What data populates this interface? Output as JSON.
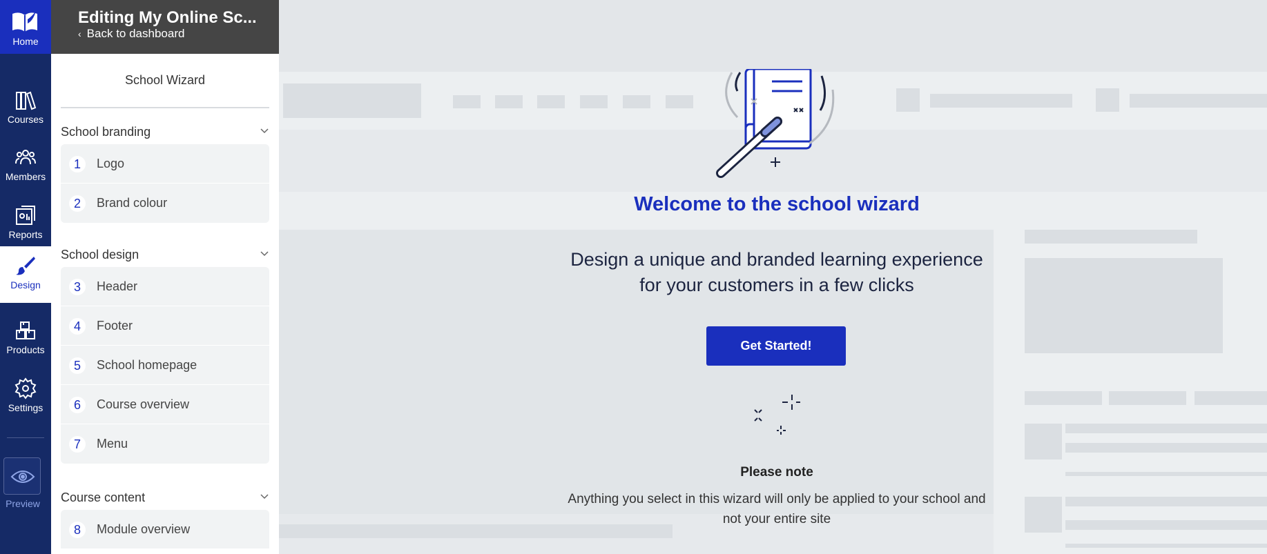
{
  "rail": {
    "home_label": "Home",
    "items": [
      {
        "label": "Courses",
        "icon": "books-icon"
      },
      {
        "label": "Members",
        "icon": "members-icon"
      },
      {
        "label": "Reports",
        "icon": "reports-icon"
      },
      {
        "label": "Design",
        "icon": "brush-icon",
        "active": true
      },
      {
        "label": "Products",
        "icon": "boxes-icon"
      },
      {
        "label": "Settings",
        "icon": "gear-icon"
      }
    ],
    "preview_label": "Preview"
  },
  "panel": {
    "title": "Editing My Online Sc...",
    "back_label": "Back to dashboard",
    "wizard_title": "School Wizard",
    "sections": [
      {
        "title": "School branding",
        "steps": [
          {
            "num": "1",
            "label": "Logo"
          },
          {
            "num": "2",
            "label": "Brand colour"
          }
        ]
      },
      {
        "title": "School design",
        "steps": [
          {
            "num": "3",
            "label": "Header"
          },
          {
            "num": "4",
            "label": "Footer"
          },
          {
            "num": "5",
            "label": "School homepage"
          },
          {
            "num": "6",
            "label": "Course overview"
          },
          {
            "num": "7",
            "label": "Menu"
          }
        ]
      },
      {
        "title": "Course content",
        "steps": [
          {
            "num": "8",
            "label": "Module overview"
          }
        ]
      }
    ]
  },
  "main": {
    "welcome": "Welcome to the school wizard",
    "lead_line1": "Design a unique and branded learning experience",
    "lead_line2": "for your customers in a few clicks",
    "cta_label": "Get Started!",
    "note_heading": "Please note",
    "note_line1": "Anything you select in this wizard will only be applied to your school and",
    "note_line2": "not your entire site"
  },
  "colors": {
    "accent": "#1a2fbd",
    "rail_bg": "#152a66",
    "panel_header_bg": "#454545",
    "preview_text": "#8ea4e6"
  }
}
